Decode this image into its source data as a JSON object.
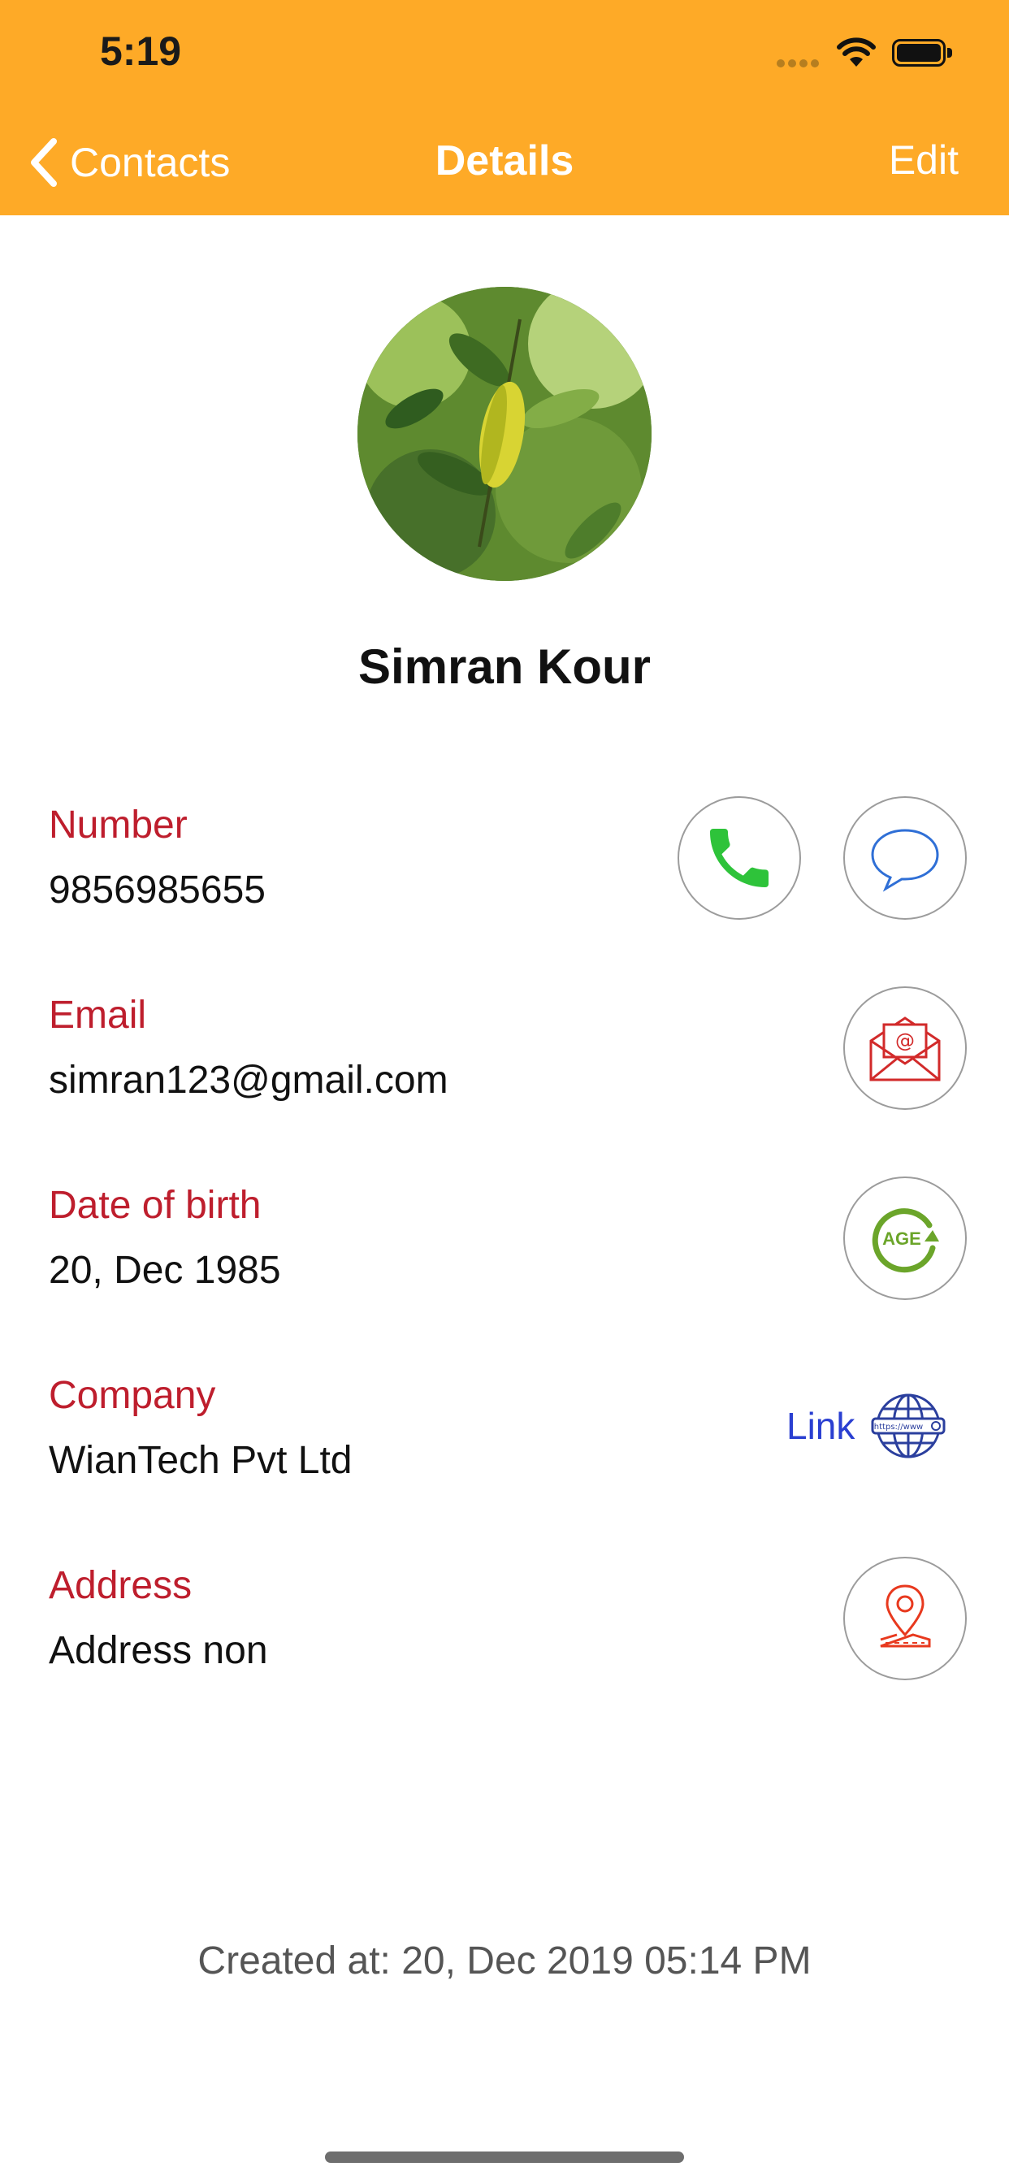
{
  "status_bar": {
    "time": "5:19"
  },
  "nav": {
    "back_label": "Contacts",
    "title": "Details",
    "edit_label": "Edit"
  },
  "contact": {
    "name": "Simran Kour",
    "number_label": "Number",
    "number": "9856985655",
    "email_label": "Email",
    "email": "simran123@gmail.com",
    "dob_label": "Date of birth",
    "dob": "20, Dec 1985",
    "company_label": "Company",
    "company": "WianTech Pvt Ltd",
    "link_label": "Link",
    "address_label": "Address",
    "address": "Address non"
  },
  "icons": {
    "call": "phone-icon",
    "message": "message-bubble-icon",
    "email": "envelope-at-icon",
    "age": "age-icon",
    "website": "globe-www-icon",
    "map": "map-pin-icon",
    "back": "chevron-left-icon"
  },
  "age_icon_text": "AGE",
  "globe_icon_text": "https://www",
  "footer": {
    "created_at": "Created at: 20, Dec 2019 05:14 PM"
  },
  "colors": {
    "header": "#FEAA27",
    "label": "#BE1E2D",
    "link": "#2A3FD1",
    "call_green": "#2EC33A"
  }
}
